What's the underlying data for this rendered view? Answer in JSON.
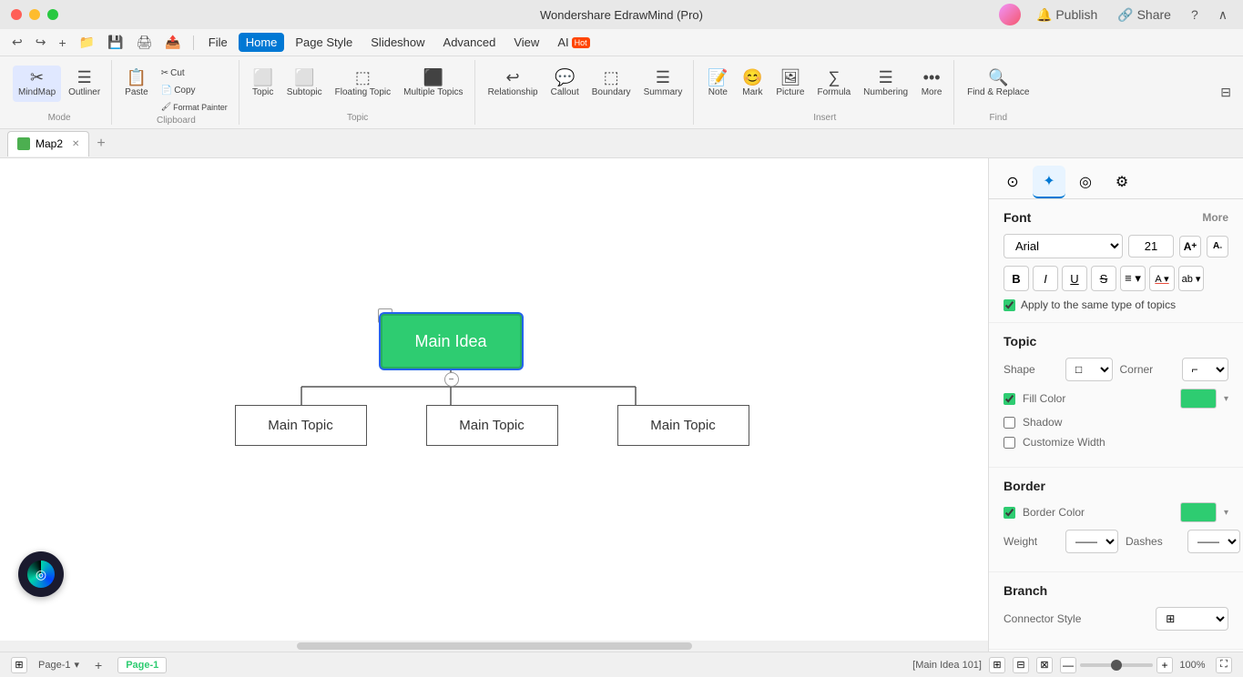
{
  "titlebar": {
    "title": "Wondershare EdrawMind (Pro)"
  },
  "menubar": {
    "items": [
      "File",
      "Home",
      "Page Style",
      "Slideshow",
      "Advanced",
      "View",
      "AI"
    ],
    "active": "Home",
    "ai_badge": "Hot",
    "right": [
      "Publish",
      "Share",
      "?",
      "∧"
    ]
  },
  "toolbar": {
    "groups": [
      {
        "label": "Mode",
        "items": [
          {
            "icon": "✂",
            "label": "MindMap",
            "active": true
          },
          {
            "icon": "☰",
            "label": "Outliner"
          }
        ]
      },
      {
        "label": "Clipboard",
        "items": [
          {
            "icon": "📋",
            "label": "Paste"
          },
          {
            "icon": "✂",
            "label": "Cut"
          },
          {
            "icon": "📄",
            "label": "Copy"
          },
          {
            "icon": "🖌",
            "label": "Format Painter"
          }
        ]
      },
      {
        "label": "Topic",
        "items": [
          {
            "icon": "⬜",
            "label": "Topic"
          },
          {
            "icon": "⬜",
            "label": "Subtopic"
          },
          {
            "icon": "⬜",
            "label": "Floating Topic"
          },
          {
            "icon": "⬜",
            "label": "Multiple Topics"
          }
        ]
      },
      {
        "label": "",
        "items": [
          {
            "icon": "↩",
            "label": "Relationship"
          },
          {
            "icon": "💬",
            "label": "Callout"
          },
          {
            "icon": "⬚",
            "label": "Boundary"
          },
          {
            "icon": "☰",
            "label": "Summary"
          }
        ]
      },
      {
        "label": "Insert",
        "items": [
          {
            "icon": "📝",
            "label": "Note"
          },
          {
            "icon": "😊",
            "label": "Mark"
          },
          {
            "icon": "🖼",
            "label": "Picture"
          },
          {
            "icon": "∑",
            "label": "Formula"
          },
          {
            "icon": "☰",
            "label": "Numbering"
          },
          {
            "icon": "•••",
            "label": "More"
          }
        ]
      },
      {
        "label": "Find",
        "items": [
          {
            "icon": "🔍",
            "label": "Find & Replace"
          }
        ]
      }
    ]
  },
  "tabs": [
    {
      "label": "Map2",
      "active": true
    }
  ],
  "canvas": {
    "main_idea": "Main Idea",
    "topics": [
      "Main Topic",
      "Main Topic",
      "Main Topic"
    ],
    "status_label": "[Main Idea 101]"
  },
  "right_panel": {
    "tabs": [
      {
        "icon": "⊙",
        "name": "style-tab",
        "active": false
      },
      {
        "icon": "✦",
        "name": "ai-tab",
        "active": true
      },
      {
        "icon": "◎",
        "name": "location-tab",
        "active": false
      },
      {
        "icon": "⚙",
        "name": "settings-tab",
        "active": false
      }
    ],
    "font": {
      "section_title": "Font",
      "more_label": "More",
      "family": "Arial",
      "size": "21",
      "size_up_icon": "A+",
      "size_down_icon": "A-",
      "bold_label": "B",
      "italic_label": "I",
      "underline_label": "U",
      "strikethrough_label": "S",
      "align_icon": "≡",
      "font_color_icon": "A",
      "highlight_icon": "ab",
      "apply_same_label": "Apply to the same type of topics"
    },
    "topic": {
      "section_title": "Topic",
      "shape_label": "Shape",
      "corner_label": "Corner",
      "fill_color_label": "Fill Color",
      "fill_color": "#2ecc71",
      "shadow_label": "Shadow",
      "customize_width_label": "Customize Width"
    },
    "border": {
      "section_title": "Border",
      "border_color_label": "Border Color",
      "border_color": "#2ecc71",
      "weight_label": "Weight",
      "dashes_label": "Dashes"
    },
    "branch": {
      "section_title": "Branch",
      "connector_style_label": "Connector Style"
    }
  },
  "statusbar": {
    "layout_icon": "⊞",
    "page_label": "Page-1",
    "page_tab": "Page-1",
    "status_info": "[Main Idea 101]",
    "icons": [
      "⊞",
      "⊟",
      "⊠"
    ],
    "zoom_minus": "—",
    "zoom_value": "100%",
    "zoom_plus": "+",
    "fullscreen_icon": "⛶",
    "add_page": "+"
  }
}
